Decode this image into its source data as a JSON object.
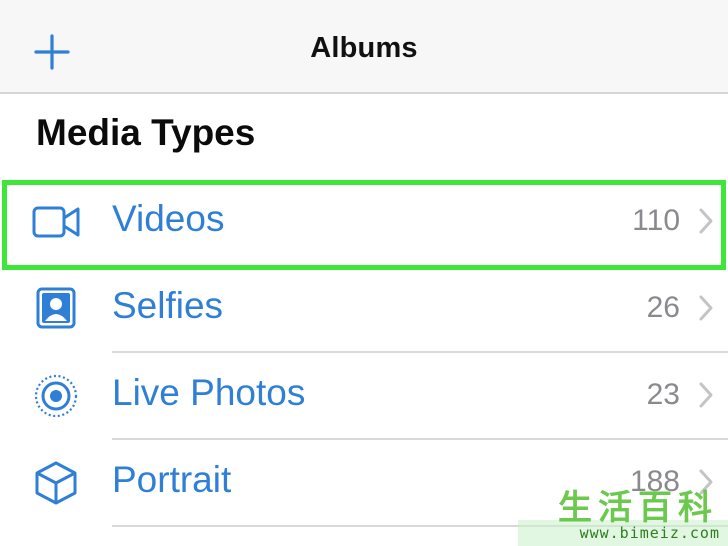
{
  "navbar": {
    "title": "Albums",
    "add_icon": "plus-icon"
  },
  "section": {
    "title": "Media Types"
  },
  "rows": [
    {
      "label": "Videos",
      "count": "110",
      "icon": "video-camera-icon"
    },
    {
      "label": "Selfies",
      "count": "26",
      "icon": "selfie-portrait-icon"
    },
    {
      "label": "Live Photos",
      "count": "23",
      "icon": "live-photo-icon"
    },
    {
      "label": "Portrait",
      "count": "188",
      "icon": "cube-icon"
    }
  ],
  "highlight": {
    "target": "Videos",
    "color": "#3ee63a"
  },
  "colors": {
    "accent": "#2f7fd6",
    "count_text": "#8a8a8e",
    "navbar_bg": "#f7f7f7"
  },
  "watermark": {
    "chars": "生活百科",
    "url": "www.bimeiz.com"
  }
}
